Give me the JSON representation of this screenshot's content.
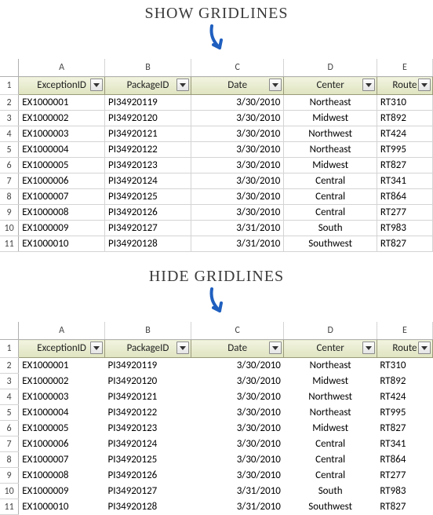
{
  "labels": {
    "show": "SHOW GRIDLINES",
    "hide": "HIDE GRIDLINES"
  },
  "sheet": {
    "columns": [
      "A",
      "B",
      "C",
      "D",
      "E"
    ],
    "row_numbers": [
      "1",
      "2",
      "3",
      "4",
      "5",
      "6",
      "7",
      "8",
      "9",
      "10",
      "11"
    ],
    "headers": [
      "ExceptionID",
      "PackageID",
      "Date",
      "Center",
      "Route"
    ],
    "rows": [
      {
        "c0": "EX1000001",
        "c1": "PI34920119",
        "c2": "3/30/2010",
        "c3": "Northeast",
        "c4": "RT310"
      },
      {
        "c0": "EX1000002",
        "c1": "PI34920120",
        "c2": "3/30/2010",
        "c3": "Midwest",
        "c4": "RT892"
      },
      {
        "c0": "EX1000003",
        "c1": "PI34920121",
        "c2": "3/30/2010",
        "c3": "Northwest",
        "c4": "RT424"
      },
      {
        "c0": "EX1000004",
        "c1": "PI34920122",
        "c2": "3/30/2010",
        "c3": "Northeast",
        "c4": "RT995"
      },
      {
        "c0": "EX1000005",
        "c1": "PI34920123",
        "c2": "3/30/2010",
        "c3": "Midwest",
        "c4": "RT827"
      },
      {
        "c0": "EX1000006",
        "c1": "PI34920124",
        "c2": "3/30/2010",
        "c3": "Central",
        "c4": "RT341"
      },
      {
        "c0": "EX1000007",
        "c1": "PI34920125",
        "c2": "3/30/2010",
        "c3": "Central",
        "c4": "RT864"
      },
      {
        "c0": "EX1000008",
        "c1": "PI34920126",
        "c2": "3/30/2010",
        "c3": "Central",
        "c4": "RT277"
      },
      {
        "c0": "EX1000009",
        "c1": "PI34920127",
        "c2": "3/31/2010",
        "c3": "South",
        "c4": "RT983"
      },
      {
        "c0": "EX1000010",
        "c1": "PI34920128",
        "c2": "3/31/2010",
        "c3": "Southwest",
        "c4": "RT827"
      }
    ]
  },
  "chart_data": {
    "type": "table",
    "title": "SHOW GRIDLINES / HIDE GRIDLINES",
    "headers": [
      "ExceptionID",
      "PackageID",
      "Date",
      "Center",
      "Route"
    ],
    "rows": [
      [
        "EX1000001",
        "PI34920119",
        "3/30/2010",
        "Northeast",
        "RT310"
      ],
      [
        "EX1000002",
        "PI34920120",
        "3/30/2010",
        "Midwest",
        "RT892"
      ],
      [
        "EX1000003",
        "PI34920121",
        "3/30/2010",
        "Northwest",
        "RT424"
      ],
      [
        "EX1000004",
        "PI34920122",
        "3/30/2010",
        "Northeast",
        "RT995"
      ],
      [
        "EX1000005",
        "PI34920123",
        "3/30/2010",
        "Midwest",
        "RT827"
      ],
      [
        "EX1000006",
        "PI34920124",
        "3/30/2010",
        "Central",
        "RT341"
      ],
      [
        "EX1000007",
        "PI34920125",
        "3/30/2010",
        "Central",
        "RT864"
      ],
      [
        "EX1000008",
        "PI34920126",
        "3/30/2010",
        "Central",
        "RT277"
      ],
      [
        "EX1000009",
        "PI34920127",
        "3/31/2010",
        "South",
        "RT983"
      ],
      [
        "EX1000010",
        "PI34920128",
        "3/31/2010",
        "Southwest",
        "RT827"
      ]
    ]
  }
}
